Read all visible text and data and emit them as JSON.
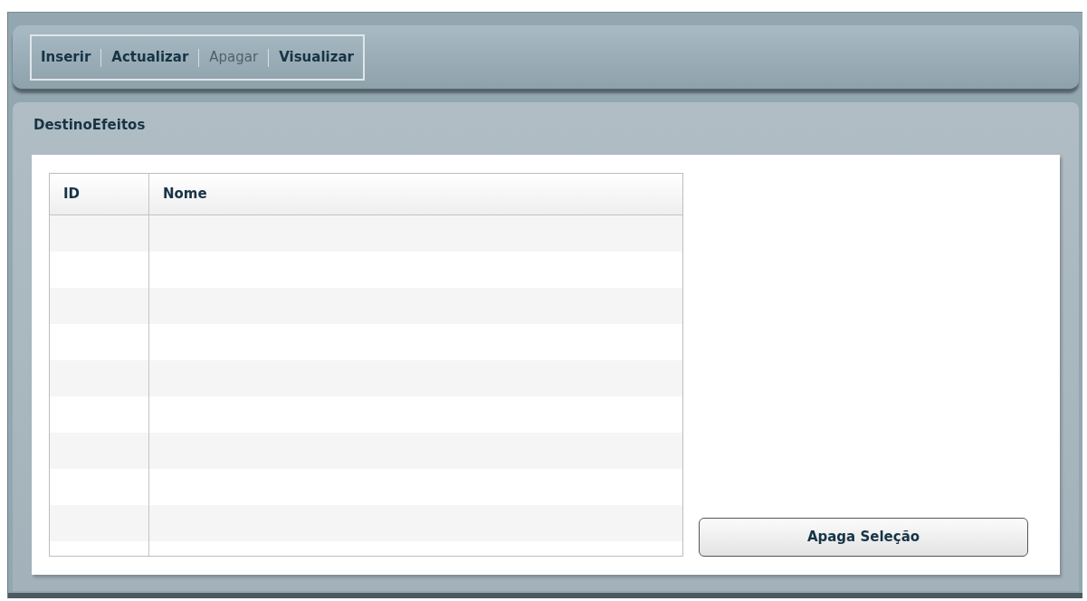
{
  "menu": [
    {
      "label": "Inserir",
      "disabled": false
    },
    {
      "label": "Actualizar",
      "disabled": false
    },
    {
      "label": "Apagar",
      "disabled": true
    },
    {
      "label": "Visualizar",
      "disabled": false
    }
  ],
  "panel": {
    "title": "DestinoEfeitos"
  },
  "table": {
    "columns": [
      "ID",
      "Nome"
    ]
  },
  "button": {
    "label": "Apaga Seleção"
  }
}
